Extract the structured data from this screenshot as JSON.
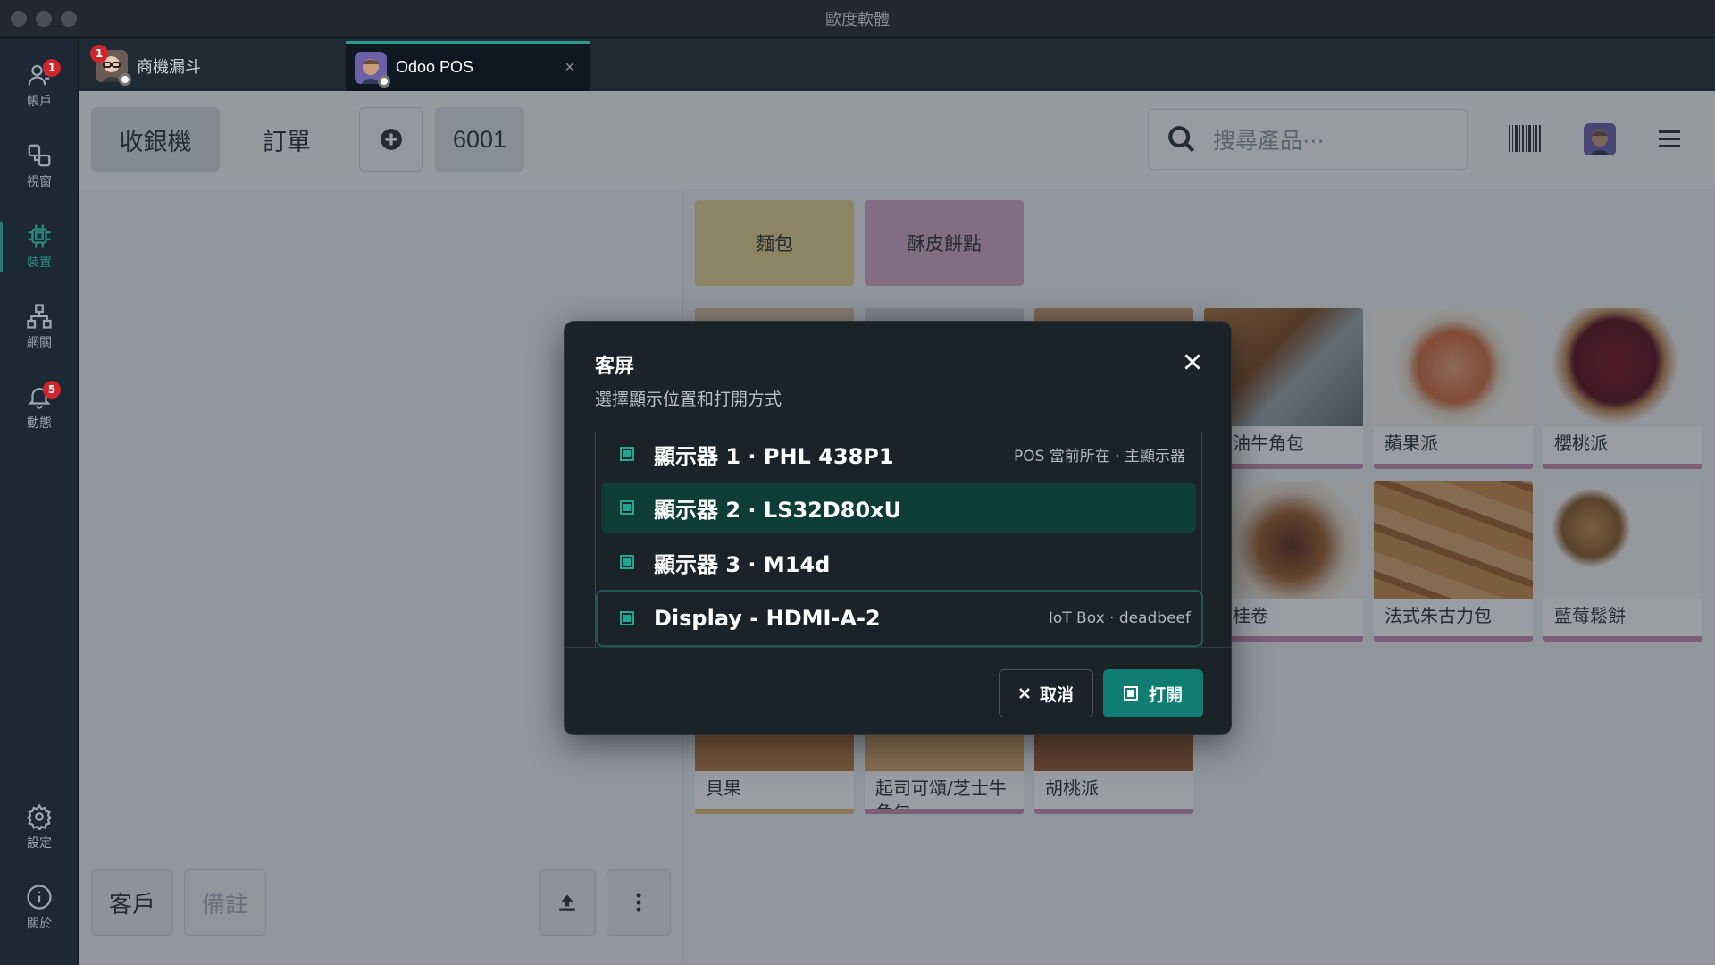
{
  "window": {
    "title": "歐度軟體"
  },
  "rail": {
    "items": [
      {
        "label": "帳戶",
        "badge": "1"
      },
      {
        "label": "視窗"
      },
      {
        "label": "裝置"
      },
      {
        "label": "網關"
      },
      {
        "label": "動態",
        "badge": "5"
      },
      {
        "label": "設定"
      },
      {
        "label": "關於"
      }
    ]
  },
  "tabs": [
    {
      "label": "商機漏斗",
      "badge": "1"
    },
    {
      "label": "Odoo POS",
      "close": "×"
    }
  ],
  "pos": {
    "nav": {
      "register": "收銀機",
      "orders": "訂單",
      "table_number": "6001"
    },
    "search_placeholder": "搜尋產品⋯",
    "left_buttons": {
      "customer": "客戶",
      "note": "備註"
    },
    "categories": [
      {
        "label": "麵包",
        "color": "#e8cf8c"
      },
      {
        "label": "酥皮餅點",
        "color": "#d6a6c8"
      }
    ],
    "products": [
      {
        "name": "奶油牛角包"
      },
      {
        "name": "蘋果派"
      },
      {
        "name": "櫻桃派"
      },
      {
        "name": "肉桂卷"
      },
      {
        "name": "法式朱古力包"
      },
      {
        "name": "藍莓鬆餅"
      },
      {
        "name": "貝果"
      },
      {
        "name": "起司可頌/芝士牛角包"
      },
      {
        "name": "胡桃派"
      }
    ]
  },
  "dialog": {
    "title": "客屏",
    "subtitle": "選擇顯示位置和打開方式",
    "options": [
      {
        "label": "顯示器 1 · PHL 438P1",
        "meta": "POS 當前所在 · 主顯示器"
      },
      {
        "label": "顯示器 2 · LS32D80xU",
        "meta": ""
      },
      {
        "label": "顯示器 3 · M14d",
        "meta": ""
      },
      {
        "label": "Display - HDMI-A-2",
        "meta": "IoT Box · deadbeef"
      }
    ],
    "cancel": "取消",
    "open": "打開"
  },
  "colors": {
    "accent": "#0f7d72",
    "badge": "#d0262b",
    "highlight_row": "#0d3d36"
  }
}
